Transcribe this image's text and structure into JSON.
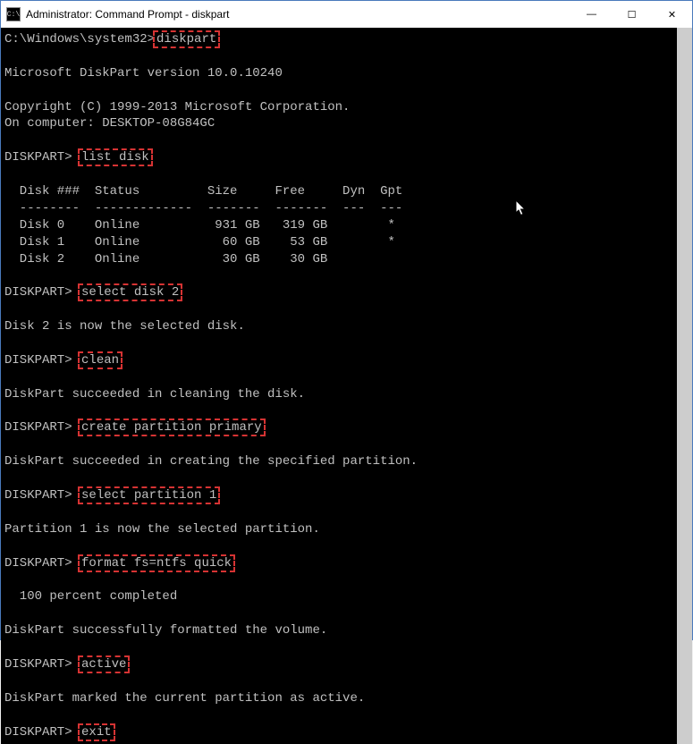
{
  "window": {
    "title": "Administrator: Command Prompt - diskpart",
    "icon_glyph": "C:\\"
  },
  "buttons": {
    "minimize": "—",
    "maximize": "☐",
    "close": "✕"
  },
  "terminal": {
    "initial_prompt": "C:\\Windows\\system32>",
    "diskpart_prompt": "DISKPART> ",
    "commands": {
      "diskpart": "diskpart",
      "list_disk": "list disk",
      "select_disk": "select disk 2",
      "clean": "clean",
      "create_partition": "create partition primary",
      "select_partition": "select partition 1",
      "format": "format fs=ntfs quick",
      "active": "active",
      "exit": "exit"
    },
    "output": {
      "version": "Microsoft DiskPart version 10.0.10240",
      "copyright": "Copyright (C) 1999-2013 Microsoft Corporation.",
      "computer": "On computer: DESKTOP-08G84GC",
      "table_header": "  Disk ###  Status         Size     Free     Dyn  Gpt",
      "table_divider": "  --------  -------------  -------  -------  ---  ---",
      "table_rows": [
        "  Disk 0    Online          931 GB   319 GB        *",
        "  Disk 1    Online           60 GB    53 GB        *",
        "  Disk 2    Online           30 GB    30 GB"
      ],
      "disk_selected": "Disk 2 is now the selected disk.",
      "clean_success": "DiskPart succeeded in cleaning the disk.",
      "create_success": "DiskPart succeeded in creating the specified partition.",
      "partition_selected": "Partition 1 is now the selected partition.",
      "format_progress": "  100 percent completed",
      "format_success": "DiskPart successfully formatted the volume.",
      "active_success": "DiskPart marked the current partition as active."
    }
  },
  "highlight_color": "#d63333"
}
